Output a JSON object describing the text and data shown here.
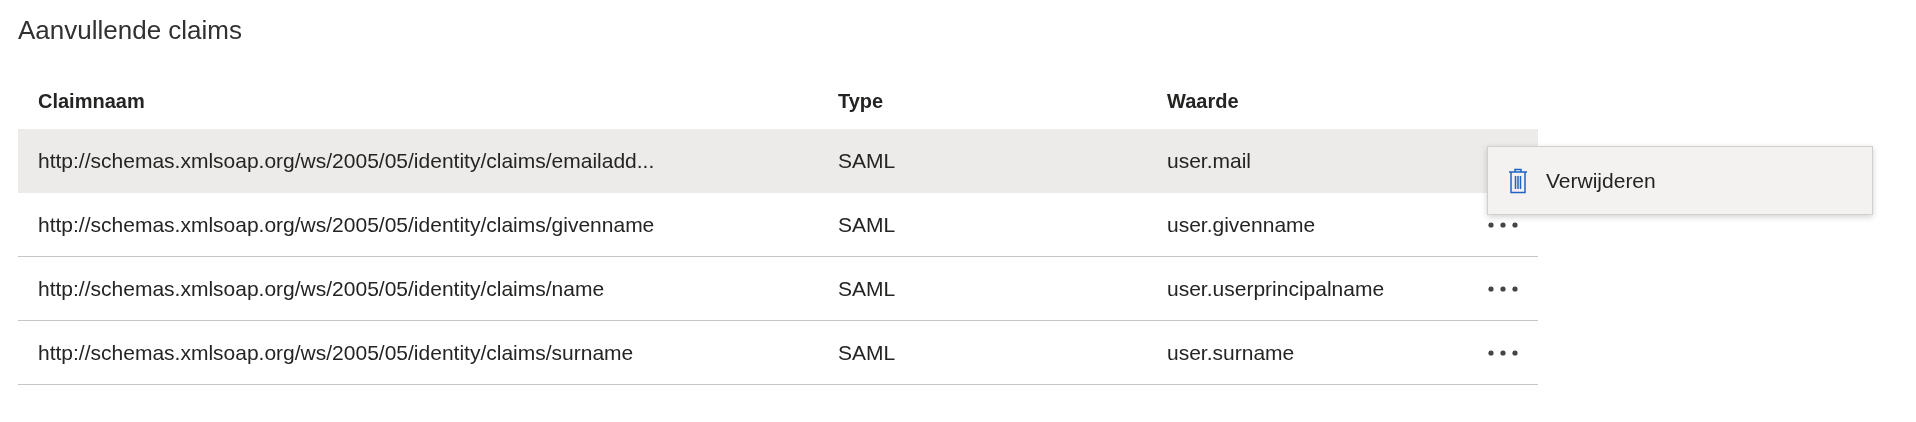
{
  "section_title": "Aanvullende claims",
  "table": {
    "columns": [
      "Claimnaam",
      "Type",
      "Waarde"
    ],
    "rows": [
      {
        "claim_name": "http://schemas.xmlsoap.org/ws/2005/05/identity/claims/emailadd...",
        "type": "SAML",
        "value": "user.mail",
        "selected": true
      },
      {
        "claim_name": "http://schemas.xmlsoap.org/ws/2005/05/identity/claims/givenname",
        "type": "SAML",
        "value": "user.givenname",
        "selected": false
      },
      {
        "claim_name": "http://schemas.xmlsoap.org/ws/2005/05/identity/claims/name",
        "type": "SAML",
        "value": "user.userprincipalname",
        "selected": false
      },
      {
        "claim_name": "http://schemas.xmlsoap.org/ws/2005/05/identity/claims/surname",
        "type": "SAML",
        "value": "user.surname",
        "selected": false
      }
    ]
  },
  "context_menu": {
    "items": [
      {
        "label": "Verwijderen"
      }
    ]
  }
}
